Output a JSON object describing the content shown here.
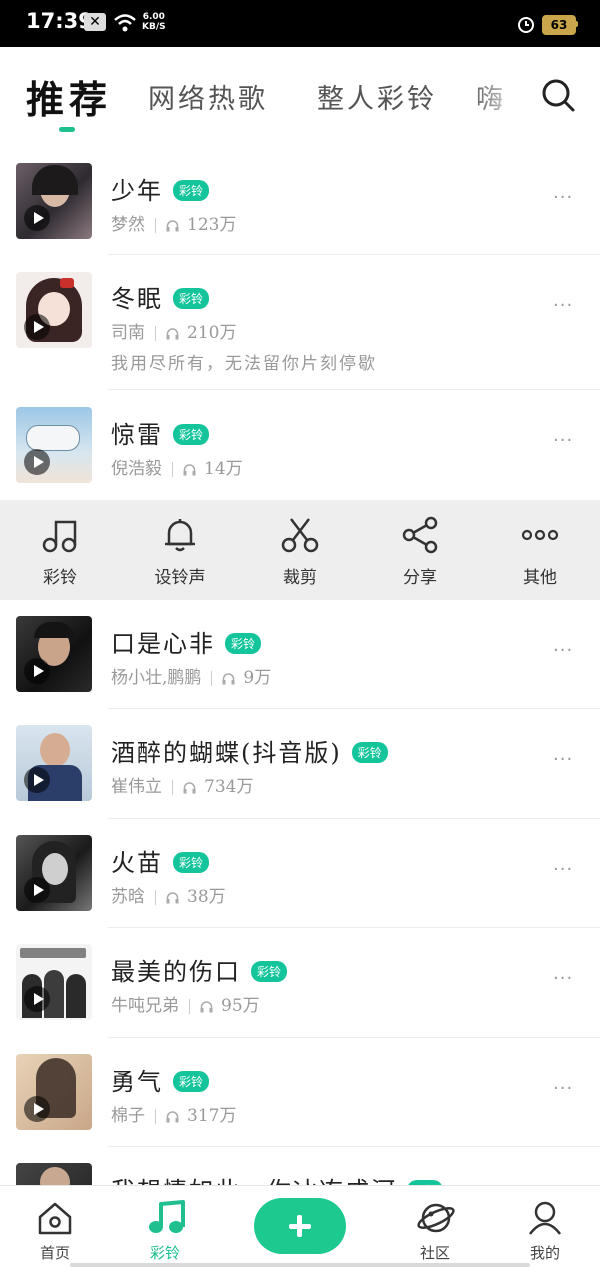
{
  "status_bar": {
    "time": "17:39",
    "speed_value": "6.00",
    "speed_unit": "KB/S",
    "battery": "63"
  },
  "tabs": [
    {
      "label": "推荐",
      "active": true
    },
    {
      "label": "网络热歌",
      "active": false
    },
    {
      "label": "整人彩铃",
      "active": false
    },
    {
      "label": "嗨",
      "active": false
    }
  ],
  "tag_label": "彩铃",
  "songs": [
    {
      "title": "少年",
      "artist": "梦然",
      "plays": "123万",
      "more": "···"
    },
    {
      "title": "冬眠",
      "artist": "司南",
      "plays": "210万",
      "desc": "我用尽所有，无法留你片刻停歇",
      "more": "···"
    },
    {
      "title": "惊雷",
      "artist": "倪浩毅",
      "plays": "14万",
      "more": "···"
    },
    {
      "title": "口是心非",
      "artist": "杨小壮,鹏鹏",
      "plays": "9万",
      "more": "···"
    },
    {
      "title": "酒醉的蝴蝶(抖音版)",
      "artist": "崔伟立",
      "plays": "734万",
      "more": "···"
    },
    {
      "title": "火苗",
      "artist": "苏晗",
      "plays": "38万",
      "more": "···"
    },
    {
      "title": "最美的伤口",
      "artist": "牛吨兄弟",
      "plays": "95万",
      "more": "···"
    },
    {
      "title": "勇气",
      "artist": "棉子",
      "plays": "317万",
      "more": "···"
    },
    {
      "title": "我想情如此，你冰冻成河"
    }
  ],
  "actions": [
    {
      "label": "彩铃",
      "icon": "music-note-icon"
    },
    {
      "label": "设铃声",
      "icon": "bell-icon"
    },
    {
      "label": "裁剪",
      "icon": "scissors-icon"
    },
    {
      "label": "分享",
      "icon": "share-icon"
    },
    {
      "label": "其他",
      "icon": "more-dots-icon"
    }
  ],
  "bottom_nav": [
    {
      "label": "首页",
      "icon": "home-icon",
      "active": false
    },
    {
      "label": "彩铃",
      "icon": "music-note-icon",
      "active": true
    },
    {
      "label": "社区",
      "icon": "planet-icon",
      "active": false
    },
    {
      "label": "我的",
      "icon": "user-icon",
      "active": false
    }
  ],
  "colors": {
    "accent": "#1fbf8f",
    "tag": "#14c49a",
    "action_bar_bg": "#eeeeee"
  }
}
